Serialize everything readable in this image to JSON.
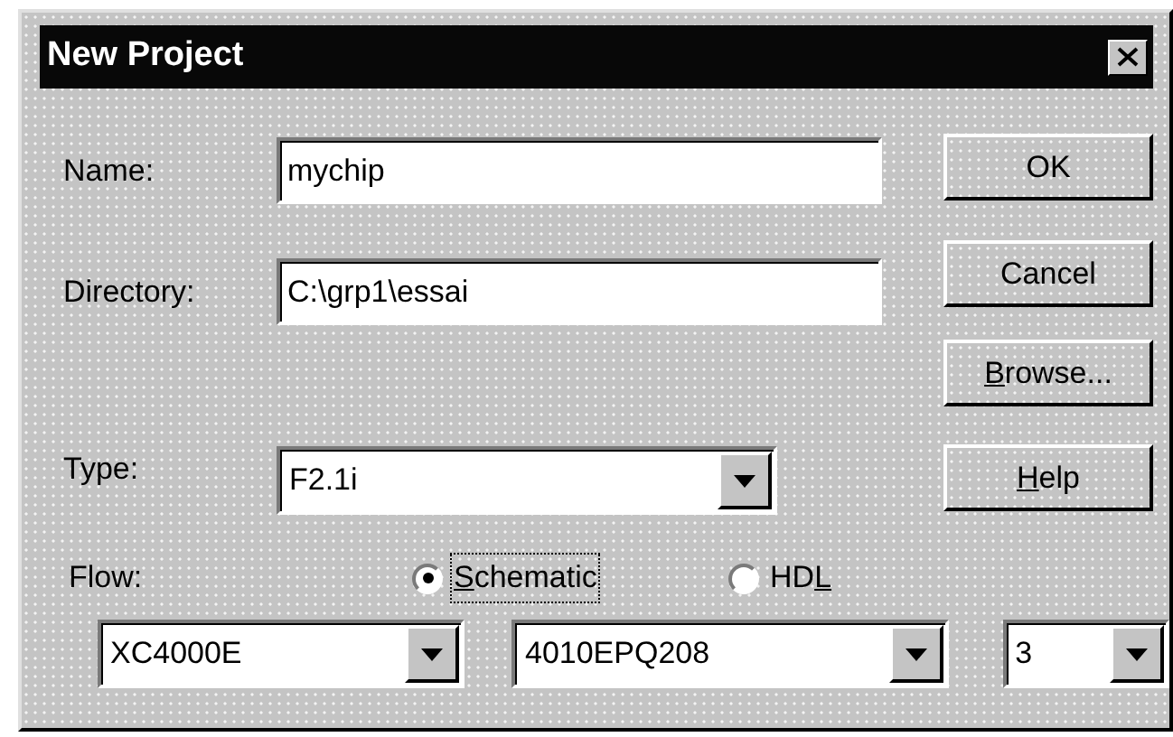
{
  "window": {
    "title": "New Project"
  },
  "fields": [
    {
      "label": "Name:",
      "value": "mychip"
    },
    {
      "label": "Directory:",
      "value": "C:\\grp1\\essai"
    }
  ],
  "type": {
    "label": "Type:",
    "value": "F2.1i"
  },
  "flow": {
    "label": "Flow:",
    "options": [
      {
        "label": {
          "key": "S",
          "post": "chematic"
        },
        "selected": true,
        "focused": true
      },
      {
        "label": {
          "pre": "HD",
          "key": "L"
        },
        "selected": false,
        "focused": false
      }
    ]
  },
  "device_selectors": [
    {
      "value": "XC4000E"
    },
    {
      "value": "4010EPQ208"
    },
    {
      "value": "3"
    }
  ],
  "buttons": [
    {
      "label": "OK"
    },
    {
      "label": "Cancel"
    },
    {
      "label": {
        "key": "B",
        "post": "rowse..."
      }
    },
    {
      "label": {
        "key": "H",
        "post": "elp"
      }
    }
  ]
}
